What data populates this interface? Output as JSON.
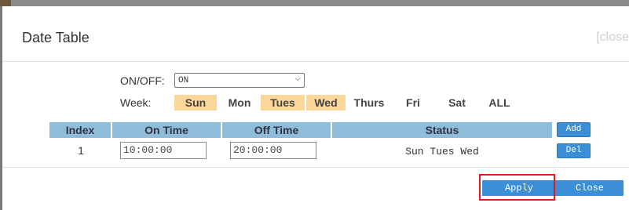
{
  "dialog": {
    "title": "Date Table",
    "close_link": "[close"
  },
  "onoff": {
    "label": "ON/OFF:",
    "value": "ON"
  },
  "week": {
    "label": "Week:",
    "days": [
      {
        "label": "Sun",
        "selected": true
      },
      {
        "label": "Mon",
        "selected": false
      },
      {
        "label": "Tues",
        "selected": true
      },
      {
        "label": "Wed",
        "selected": true
      },
      {
        "label": "Thurs",
        "selected": false
      },
      {
        "label": "Fri",
        "selected": false
      },
      {
        "label": "Sat",
        "selected": false
      },
      {
        "label": "ALL",
        "selected": false
      }
    ]
  },
  "table": {
    "headers": [
      "Index",
      "On Time",
      "Off Time",
      "Status"
    ],
    "add_label": "Add",
    "rows": [
      {
        "index": "1",
        "on_time": "10:00:00",
        "off_time": "20:00:00",
        "status": "Sun Tues Wed",
        "del_label": "Del"
      }
    ]
  },
  "footer": {
    "apply_label": "Apply",
    "close_label": "Close"
  },
  "colors": {
    "accent": "#3a8fd6",
    "header_bg": "#8fbcd9",
    "day_selected": "#fbd79a",
    "highlight": "#e01b1b"
  },
  "icons": {
    "select_chevron": "chevron-down-icon"
  }
}
